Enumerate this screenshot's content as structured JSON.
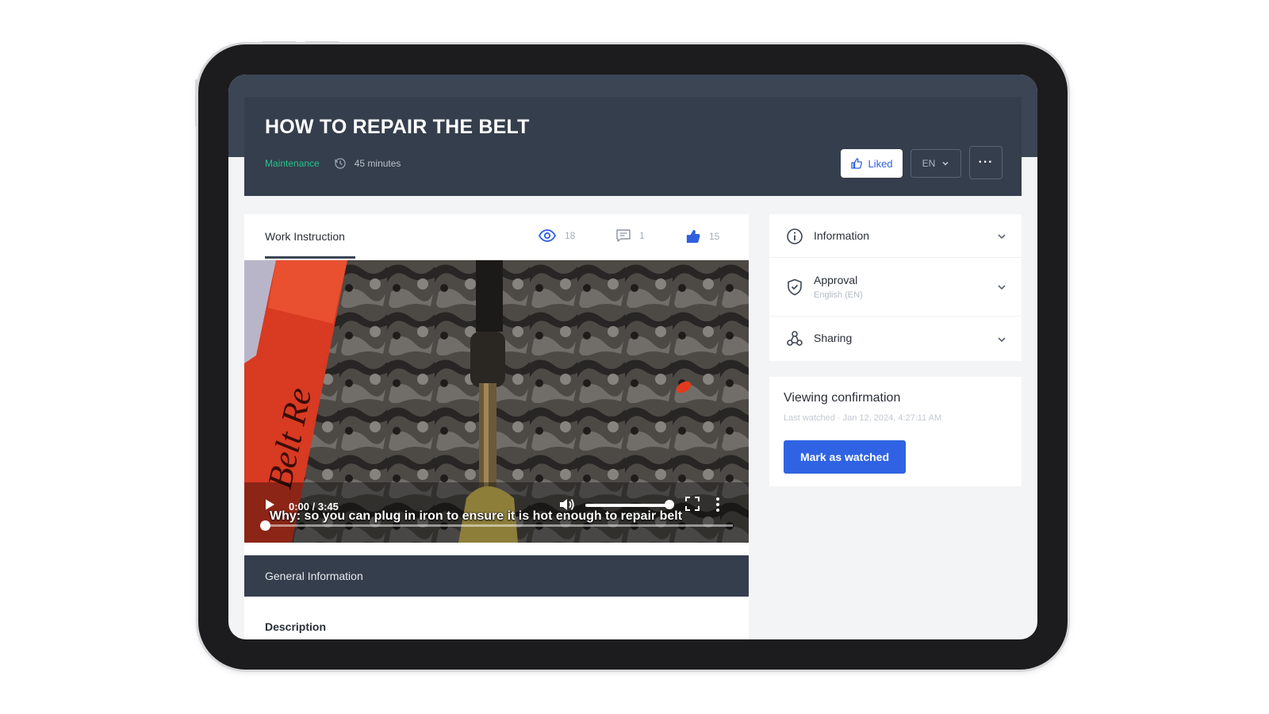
{
  "header": {
    "title": "HOW TO REPAIR THE BELT",
    "category": "Maintenance",
    "duration": "45 minutes",
    "liked_label": "Liked",
    "language": "EN",
    "more_label": "···"
  },
  "tabs": {
    "active_tab": "Work Instruction",
    "views_count": "18",
    "comments_count": "1",
    "likes_count": "15"
  },
  "video": {
    "time": "0:00 / 3:45",
    "subtitle": "Why: so you can plug in iron to ensure it is hot enough to repair belt",
    "progress": 0,
    "volume": 1.0,
    "box_label": "Belt Re"
  },
  "general_info": {
    "label": "General Information",
    "description_label": "Description"
  },
  "sidebar": {
    "sections": [
      {
        "label": "Information",
        "icon": "info-icon"
      },
      {
        "label": "Approval",
        "sub": "English (EN)",
        "icon": "shield-check-icon"
      },
      {
        "label": "Sharing",
        "icon": "share-nodes-icon"
      }
    ]
  },
  "viewing": {
    "title": "Viewing confirmation",
    "last_watched": "Last watched · Jan 12, 2024, 4:27:11 AM",
    "button_label": "Mark as watched"
  },
  "colors": {
    "header_bg": "#353e4c",
    "accent_blue": "#2f63e3",
    "category_green": "#22c38e"
  }
}
